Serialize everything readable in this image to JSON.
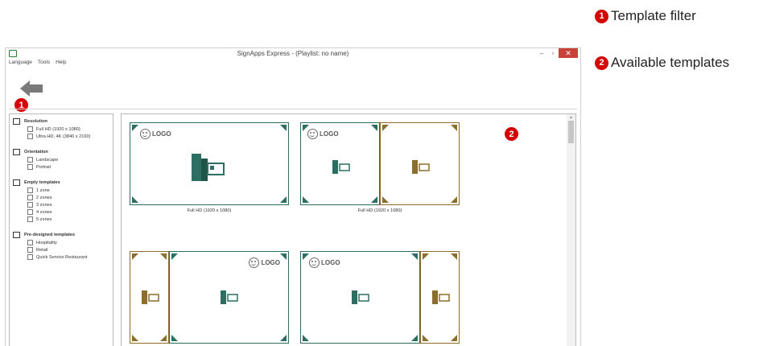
{
  "annotations": [
    {
      "number": "1",
      "label": "Template filter"
    },
    {
      "number": "2",
      "label": "Available templates"
    }
  ],
  "window": {
    "title": "SignApps Express - (Playlist: no name)",
    "controls": {
      "minimize": "–",
      "maximize": "▫",
      "close": "✕"
    }
  },
  "menu": [
    "Language",
    "Tools",
    "Help"
  ],
  "filters": {
    "resolution": {
      "title": "Resolution",
      "options": [
        "Full HD (1920 x 1080)",
        "Ultra HD, 4K (3840 x 2160)"
      ]
    },
    "orientation": {
      "title": "Orientation",
      "options": [
        "Landscape",
        "Portrait"
      ]
    },
    "empty": {
      "title": "Empty templates",
      "options": [
        "1 zone",
        "2 zones",
        "3 zones",
        "4 zones",
        "5 zones"
      ]
    },
    "predesigned": {
      "title": "Pre-designed templates",
      "options": [
        "Hospitality",
        "Retail",
        "Quick Service Restaurant"
      ]
    }
  },
  "templates": [
    {
      "caption": "Full HD (1920 x 1080)",
      "logo": "LOGO"
    },
    {
      "caption": "Full HD (1920 x 1080)",
      "logo": "LOGO"
    },
    {
      "caption": "",
      "logo": "LOGO"
    },
    {
      "caption": "",
      "logo": "LOGO"
    }
  ],
  "colors": {
    "accent_red": "#d40000",
    "zone_teal": "#2c6e62",
    "zone_brown": "#8b6d2c",
    "close_button": "#c9423a"
  },
  "icons": [
    "back-arrow-icon",
    "smiley-icon",
    "media-icon",
    "app-icon"
  ]
}
